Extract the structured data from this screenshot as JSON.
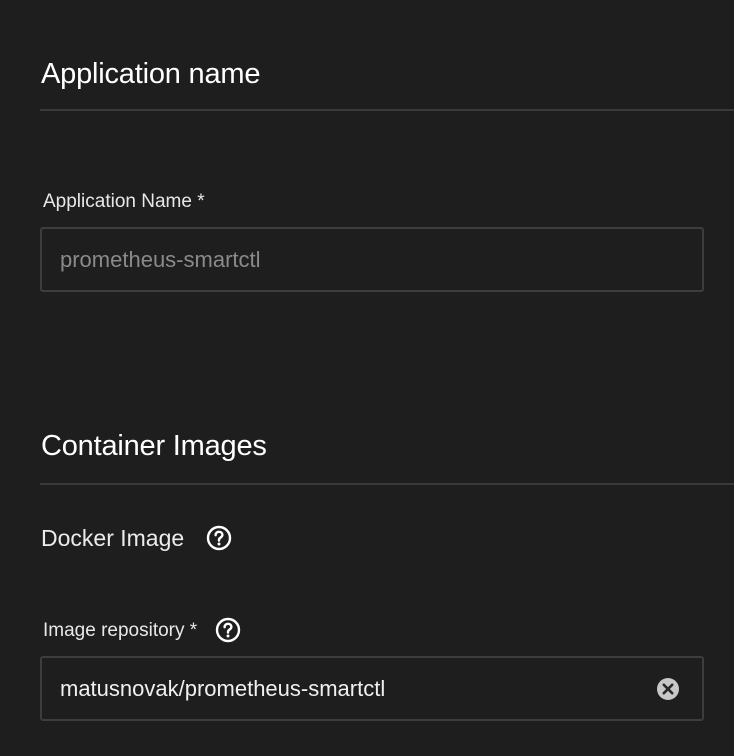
{
  "application_name_section": {
    "title": "Application name",
    "field_label": "Application Name *",
    "field_value": "prometheus-smartctl"
  },
  "container_images_section": {
    "title": "Container Images",
    "docker_image_title": "Docker Image",
    "image_repository_label": "Image repository *",
    "image_repository_value": "matusnovak/prometheus-smartctl"
  },
  "icons": {
    "help": "question-circle-icon",
    "clear": "close-circle-icon"
  },
  "colors": {
    "background": "#1e1e1e",
    "border": "#3d3d3d",
    "text": "#f2f2f2",
    "disabled_text": "#8a8a8a"
  }
}
